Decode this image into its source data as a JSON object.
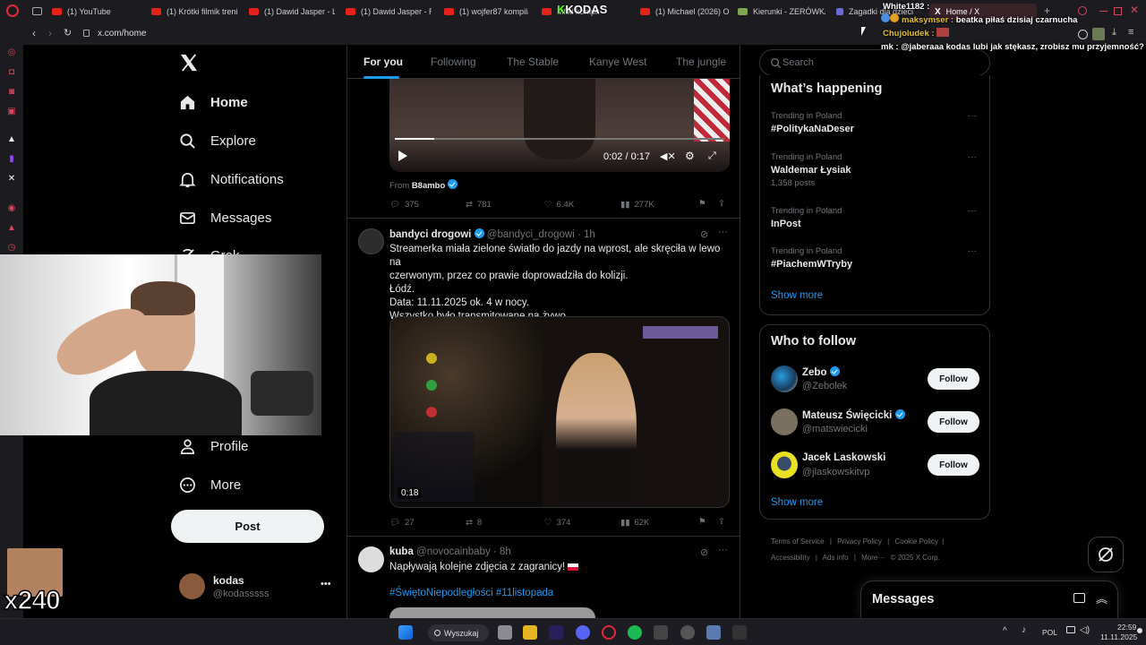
{
  "browser": {
    "tabs": [
      {
        "label": "(1) YouTube"
      },
      {
        "label": "(1) Krótki filmik treni"
      },
      {
        "label": "(1) Dawid Jasper - L"
      },
      {
        "label": "(1) Dawid Jasper - R"
      },
      {
        "label": "(1) wojfer87 kompila"
      },
      {
        "label": "Mfiki kompk"
      },
      {
        "label": "(1) Michael (2026) O"
      },
      {
        "label": "Kierunki - ZERÓWKA"
      },
      {
        "label": "Zagadki dla dzieci"
      },
      {
        "label": "Home / X"
      }
    ],
    "url": "x.com/home"
  },
  "stream_overlay": {
    "kodas_logo": "KODAS",
    "chat": [
      {
        "user": "White1182 :",
        "message": ""
      },
      {
        "user": "maksymser :",
        "message": "beatka piłaś dzisiaj czarnucha"
      },
      {
        "user": "Chujoludek :",
        "message": ""
      },
      {
        "user": "mk :",
        "message": "@jaberaaa kodas lubi jak stękasz, zrobisz mu przyjemność?"
      }
    ],
    "combo_count": "x240"
  },
  "nav": {
    "items": [
      {
        "label": "Home"
      },
      {
        "label": "Explore"
      },
      {
        "label": "Notifications"
      },
      {
        "label": "Messages"
      },
      {
        "label": "Grok"
      },
      {
        "label": "Profile"
      },
      {
        "label": "More"
      }
    ],
    "post_button": "Post",
    "account": {
      "name": "kodas",
      "handle": "@kodasssss"
    }
  },
  "timeline": {
    "tabs": [
      "For you",
      "Following",
      "The Stable",
      "Kanye West",
      "The jungle"
    ],
    "video_post": {
      "time": "0:02 / 0:17",
      "from_label": "From",
      "from_user": "B8ambo",
      "replies": "375",
      "reposts": "781",
      "likes": "6.4K",
      "views": "277K"
    },
    "post2": {
      "name": "bandyci drogowi",
      "handle": "@bandyci_drogowi",
      "time": "· 1h",
      "lines": [
        "Streamerka miała zielone światło do jazdy na wprost, ale skręciła w lewo na",
        "czerwonym, przez co prawie doprowadziła do kolizji.",
        "Łódź.",
        "Data: 11.11.2025 ok. 4 w nocy.",
        "Wszystko było transmitowane na żywo."
      ],
      "video_time": "0:18",
      "replies": "27",
      "reposts": "8",
      "likes": "374",
      "views": "62K"
    },
    "post3": {
      "name": "kuba",
      "handle": "@novocainbaby",
      "time": "· 8h",
      "text": "Napływają kolejne zdjęcia z zagranicy!",
      "hashtags": "#ŚwiętoNiepodległości #11listopada"
    }
  },
  "sidebar": {
    "search_placeholder": "Search",
    "happening_title": "What’s happening",
    "trends": [
      {
        "context": "Trending in Poland",
        "title": "#PolitykaNaDeser",
        "count": ""
      },
      {
        "context": "Trending in Poland",
        "title": "Waldemar Łysiak",
        "count": "1,358 posts"
      },
      {
        "context": "Trending in Poland",
        "title": "InPost",
        "count": ""
      },
      {
        "context": "Trending in Poland",
        "title": "#PiachemWTryby",
        "count": ""
      }
    ],
    "show_more": "Show more",
    "who_to_follow_title": "Who to follow",
    "follow_suggestions": [
      {
        "name": "Zebo",
        "handle": "@Zebolek",
        "button": "Follow"
      },
      {
        "name": "Mateusz Święcicki",
        "handle": "@matswiecicki",
        "button": "Follow"
      },
      {
        "name": "Jacek Laskowski",
        "handle": "@jlaskowskitvp",
        "button": "Follow"
      }
    ],
    "show_more2": "Show more",
    "footer_links": [
      "Terms of Service",
      "Privacy Policy",
      "Cookie Policy",
      "Accessibility",
      "Ads info",
      "More···",
      "© 2025 X Corp."
    ],
    "messages_title": "Messages"
  },
  "taskbar": {
    "search_label": "Wyszukaj",
    "lang": "POL",
    "time": "22:59",
    "date": "11.11.2025"
  }
}
